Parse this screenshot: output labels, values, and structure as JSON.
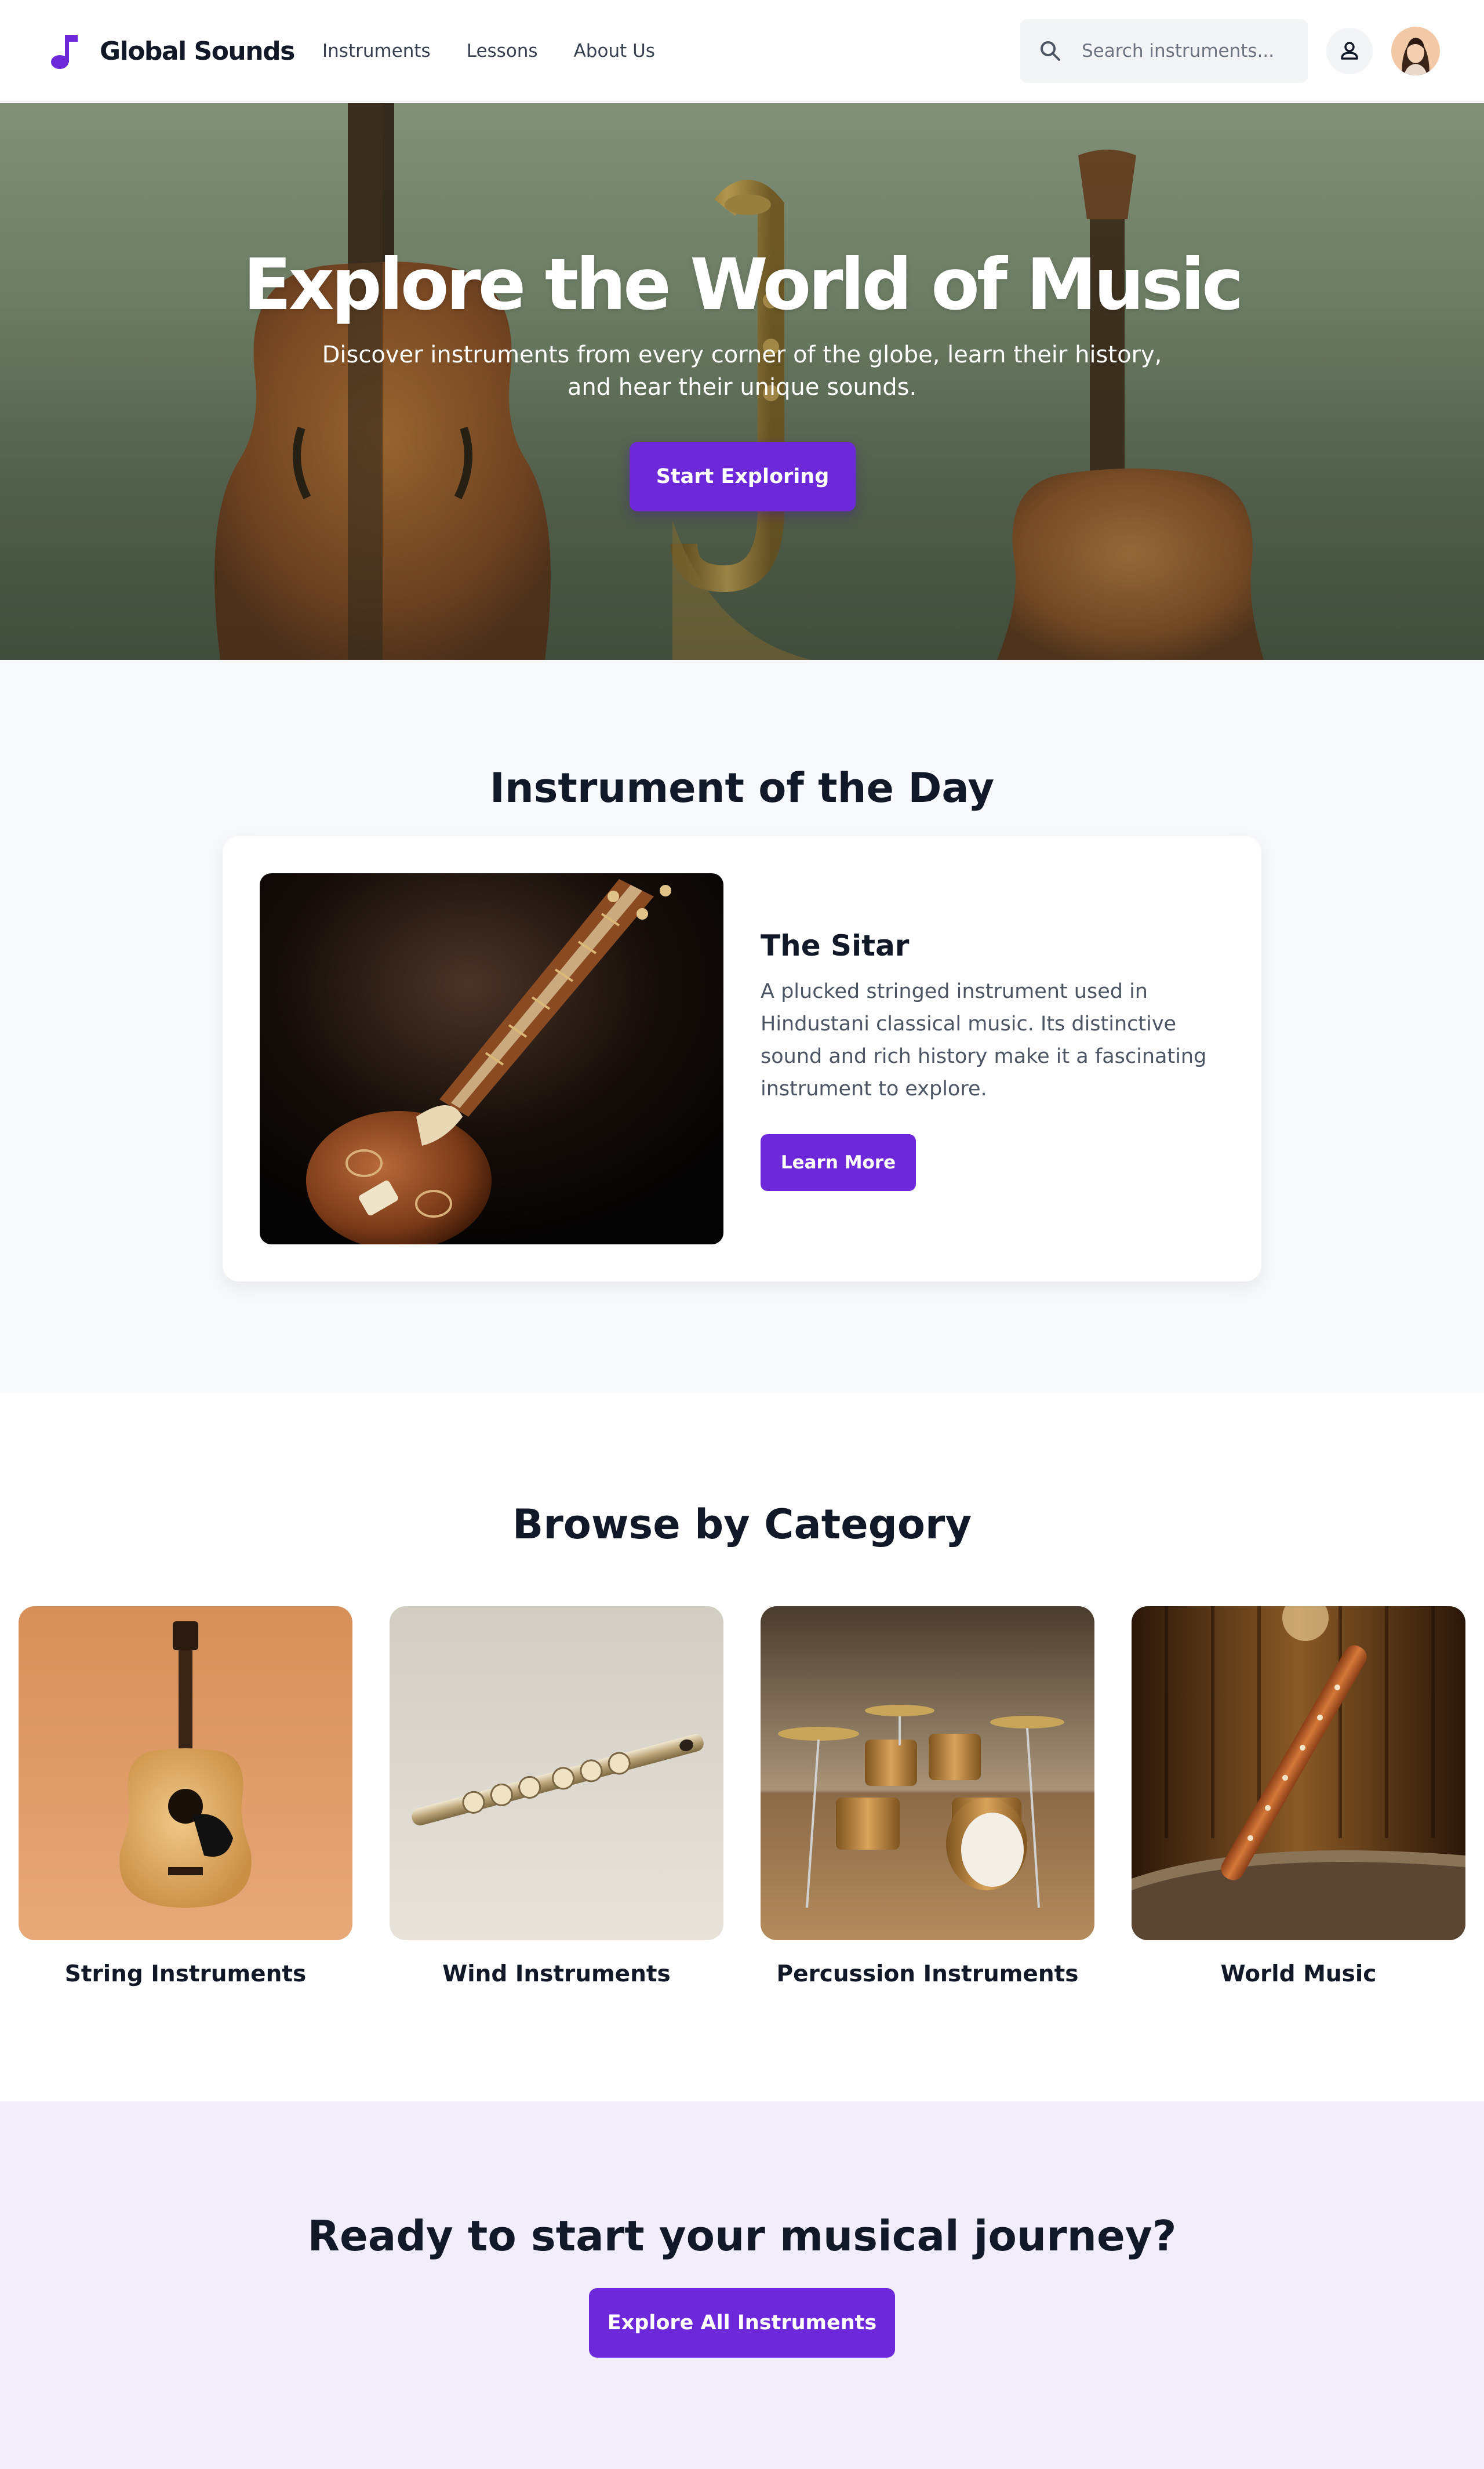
{
  "header": {
    "logo_icon": "music-note-icon",
    "brand": "Global Sounds",
    "nav": [
      {
        "label": "Instruments"
      },
      {
        "label": "Lessons"
      },
      {
        "label": "About Us"
      }
    ],
    "search": {
      "placeholder": "Search instruments...",
      "value": "",
      "icon": "search-icon"
    },
    "user_icon": "user-icon",
    "avatar": "user-avatar"
  },
  "hero": {
    "title": "Explore the World of Music",
    "subtitle": "Discover instruments from every corner of the globe, learn their history, and hear their unique sounds.",
    "button": "Start Exploring"
  },
  "instrument_of_day": {
    "heading": "Instrument of the Day",
    "name": "The Sitar",
    "description": "A plucked stringed instrument used in Hindustani classical music. Its distinctive sound and rich history make it a fascinating instrument to explore.",
    "button": "Learn More"
  },
  "categories": {
    "heading": "Browse by Category",
    "items": [
      {
        "label": "String Instruments"
      },
      {
        "label": "Wind Instruments"
      },
      {
        "label": "Percussion Instruments"
      },
      {
        "label": "World Music"
      }
    ]
  },
  "cta": {
    "title": "Ready to start your musical journey?",
    "button": "Explore All Instruments"
  },
  "colors": {
    "accent": "#6d28d9",
    "cta_background": "#f1edfb",
    "section_background": "#f8f9fc"
  }
}
